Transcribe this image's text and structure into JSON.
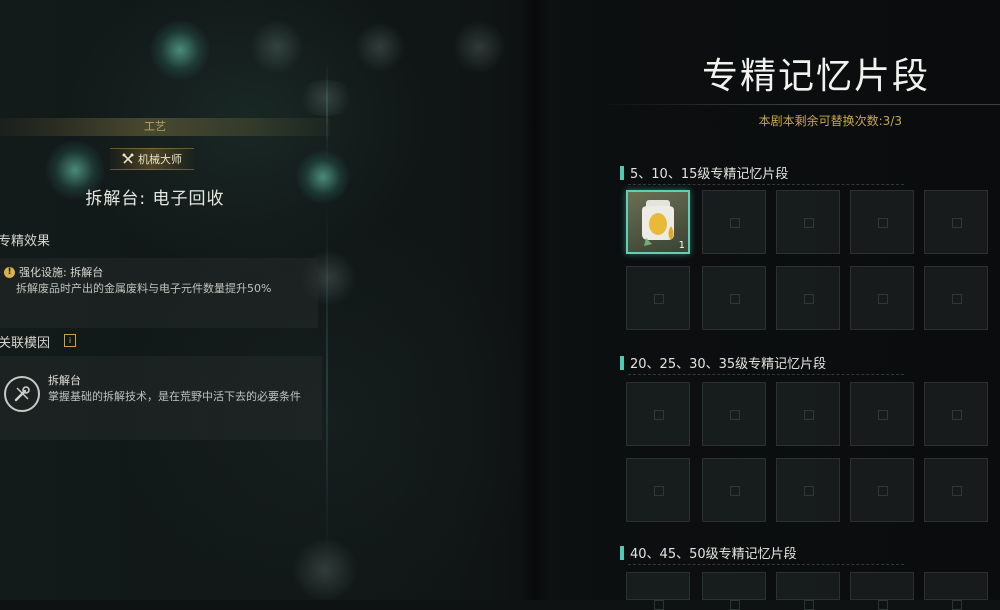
{
  "left_panel": {
    "category": "工艺",
    "master_badge": "机械大师",
    "facility_title": "拆解台: 电子回收",
    "effect_section_title": "专精效果",
    "effect_name": "强化设施: 拆解台",
    "effect_description": "拆解废品时产出的金属废料与电子元件数量提升50%",
    "gene_section_title": "关联模因",
    "gene_tag": "i",
    "gene_name": "拆解台",
    "gene_description": "掌握基础的拆解技术，是在荒野中活下去的必要条件"
  },
  "right_panel": {
    "title": "专精记忆片段",
    "remaining": "本剧本剩余可替换次数:3/3",
    "tiers": [
      {
        "label": "5、10、15级专精记忆片段"
      },
      {
        "label": "20、25、30、35级专精记忆片段"
      },
      {
        "label": "40、45、50级专精记忆片段"
      }
    ],
    "equipped_item": {
      "icon": "gear-bag-icon",
      "count": "1"
    }
  },
  "colors": {
    "accent_teal": "#5fd0b8",
    "accent_gold": "#c9a84a"
  }
}
